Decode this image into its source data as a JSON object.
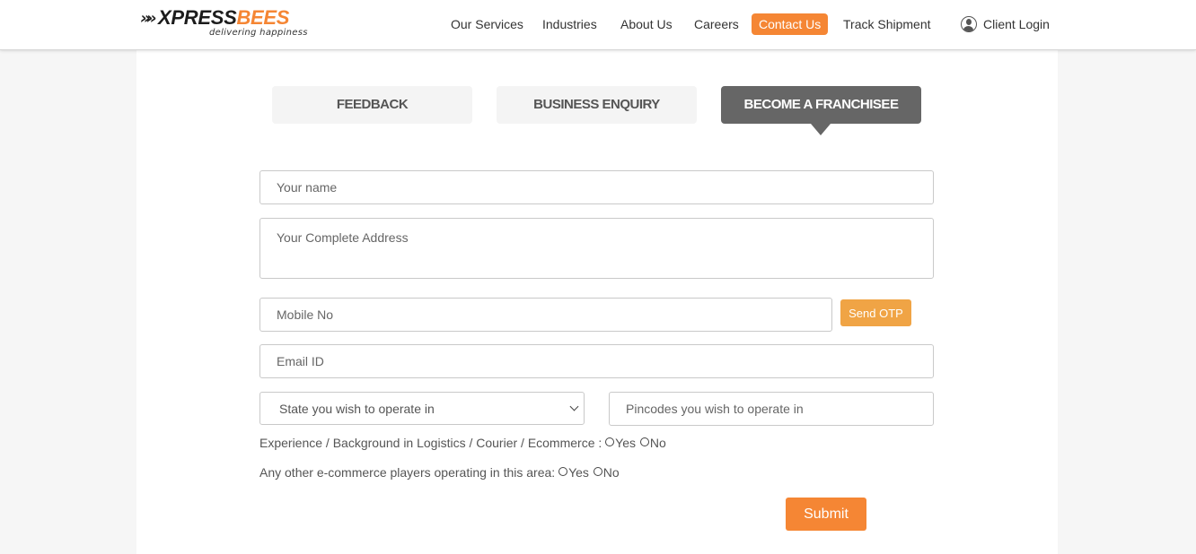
{
  "brand": {
    "logo_chevrons": "»»",
    "logo_word_1": "XPRESS",
    "logo_word_2": "BEES",
    "tagline": "delivering happiness",
    "accent_color": "#f58634"
  },
  "nav": {
    "items": [
      {
        "label": "Our Services"
      },
      {
        "label": "Industries"
      },
      {
        "label": "About Us"
      },
      {
        "label": "Careers"
      },
      {
        "label": "Contact Us",
        "active": true
      },
      {
        "label": "Track Shipment"
      }
    ],
    "client_login": "Client Login",
    "client_login_icon": "user-circle-icon"
  },
  "tabs": [
    {
      "label": "FEEDBACK",
      "active": false
    },
    {
      "label": "BUSINESS ENQUIRY",
      "active": false
    },
    {
      "label": "BECOME A FRANCHISEE",
      "active": true
    }
  ],
  "form": {
    "name_placeholder": "Your name",
    "name_value": "",
    "address_placeholder": "Your Complete Address",
    "address_value": "",
    "mobile_placeholder": "Mobile No",
    "mobile_value": "",
    "send_otp_label": "Send OTP",
    "email_placeholder": "Email ID",
    "email_value": "",
    "state_selected": "State you wish to operate in",
    "pincodes_placeholder": "Pincodes you wish to operate in",
    "pincodes_value": "",
    "q1_label": "Experience / Background in Logistics / Courier / Ecommerce : ",
    "q2_label": "Any other e-commerce players operating in this area:",
    "yes_label": "Yes",
    "no_label": "No",
    "submit_label": "Submit"
  }
}
